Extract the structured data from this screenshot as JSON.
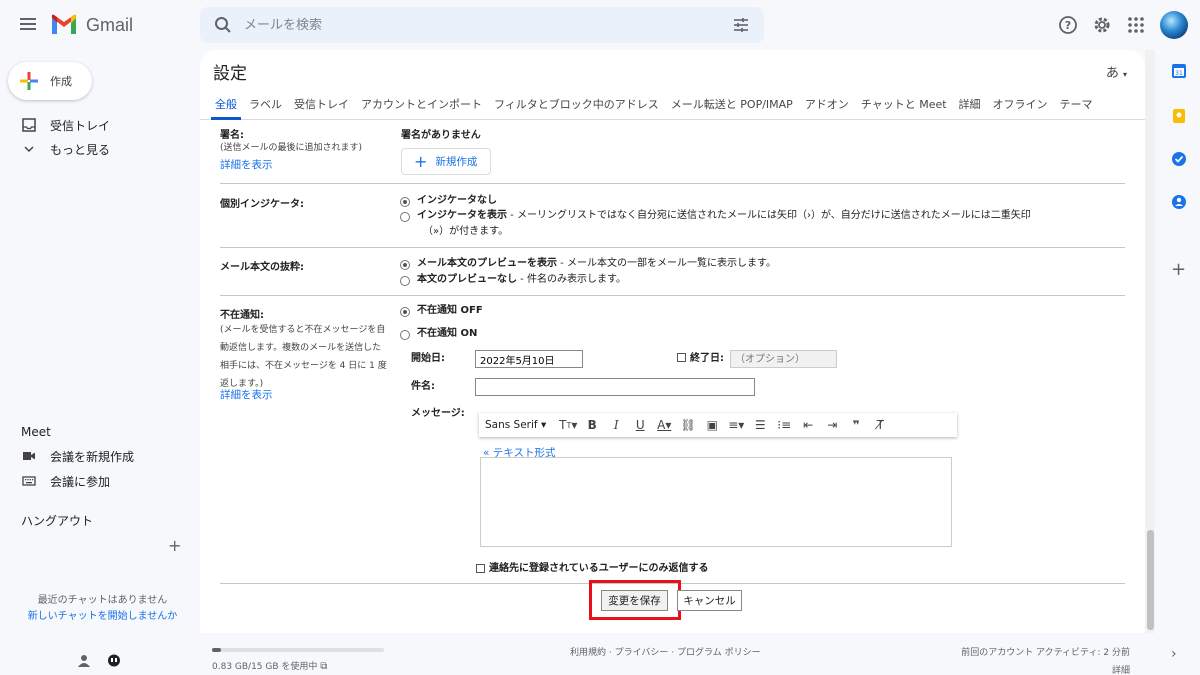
{
  "app": {
    "name": "Gmail"
  },
  "search": {
    "placeholder": "メールを検索"
  },
  "sidebar": {
    "compose_label": "作成",
    "items": [
      {
        "label": "受信トレイ",
        "icon": "inbox-icon"
      },
      {
        "label": "もっと見る",
        "icon": "chevron-down-icon"
      }
    ],
    "meet_title": "Meet",
    "meet_items": [
      {
        "label": "会議を新規作成",
        "icon": "video-icon"
      },
      {
        "label": "会議に参加",
        "icon": "keyboard-icon"
      }
    ],
    "hangouts_title": "ハングアウト",
    "no_chats": "最近のチャットはありません",
    "new_chat": "新しいチャットを開始しませんか"
  },
  "settings": {
    "title": "設定",
    "input_method": "あ",
    "tabs": [
      {
        "label": "全般",
        "active": true
      },
      {
        "label": "ラベル"
      },
      {
        "label": "受信トレイ"
      },
      {
        "label": "アカウントとインポート"
      },
      {
        "label": "フィルタとブロック中のアドレス"
      },
      {
        "label": "メール転送と POP/IMAP"
      },
      {
        "label": "アドオン"
      },
      {
        "label": "チャットと Meet"
      },
      {
        "label": "詳細"
      },
      {
        "label": "オフライン"
      },
      {
        "label": "テーマ"
      }
    ],
    "signature": {
      "label": "署名:",
      "desc": "(送信メールの最後に追加されます)",
      "details_link": "詳細を表示",
      "status": "署名がありません",
      "new_button": "新規作成"
    },
    "indicators": {
      "label": "個別インジケータ:",
      "option1": "インジケータなし",
      "option2_bold": "インジケータを表示",
      "option2_desc": " - メーリングリストではなく自分宛に送信されたメールには矢印（›）が、自分だけに送信されたメールには二重矢印",
      "option2_desc2": "（»）が付きます。"
    },
    "snippets": {
      "label": "メール本文の抜粋:",
      "option1_bold": "メール本文のプレビューを表示",
      "option1_desc": " - メール本文の一部をメール一覧に表示します。",
      "option2_bold": "本文のプレビューなし",
      "option2_desc": " - 件名のみ表示します。"
    },
    "vacation": {
      "label": "不在通知:",
      "desc_lines": [
        "(メールを受信すると不在メッセージを自",
        "動返信します。複数のメールを送信した",
        "相手には、不在メッセージを 4 日に 1 度",
        "返します。)"
      ],
      "details_link": "詳細を表示",
      "off_label": "不在通知 OFF",
      "on_label": "不在通知 ON",
      "start_label": "開始日:",
      "start_value": "2022年5月10日",
      "end_label": "終了日:",
      "end_placeholder": "（オプション）",
      "subject_label": "件名:",
      "subject_value": "",
      "message_label": "メッセージ:",
      "toolbar_font": "Sans Serif",
      "plain_text_link": "« テキスト形式",
      "contacts_only": "連絡先に登録されているユーザーにのみ返信する"
    },
    "save_button": "変更を保存",
    "cancel_button": "キャンセル"
  },
  "footer": {
    "storage_text": "0.83 GB/15 GB を使用中",
    "storage_fraction": 0.055,
    "links": "利用規約 · プライバシー · プログラム ポリシー",
    "last_activity": "前回のアカウント アクティビティ: 2 分前",
    "details": "詳細"
  },
  "colors": {
    "accent": "#0b57d0",
    "highlight": "#e8101e",
    "link": "#1a73e8"
  }
}
